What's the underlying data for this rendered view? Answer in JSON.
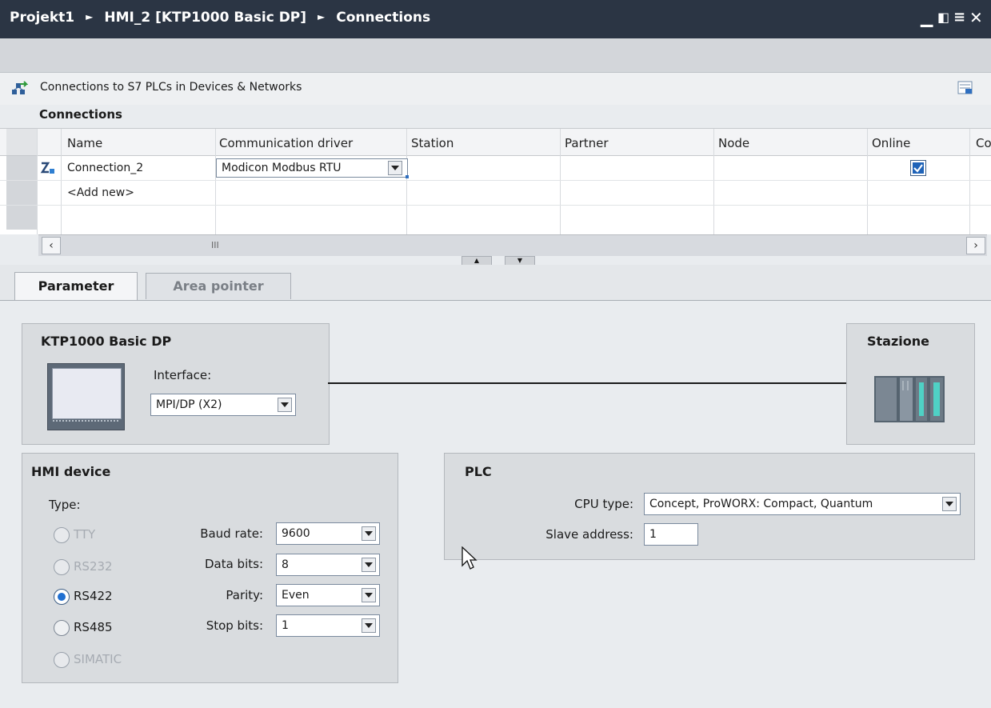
{
  "breadcrumb": [
    "Projekt1",
    "HMI_2 [KTP1000 Basic DP]",
    "Connections"
  ],
  "window_controls": [
    "minimize-icon",
    "restore-icon",
    "maximize-icon",
    "close-icon"
  ],
  "s7_link_label": "Connections to S7 PLCs in Devices & Networks",
  "connections_title": "Connections",
  "columns": [
    "Name",
    "Communication driver",
    "Station",
    "Partner",
    "Node",
    "Online",
    "Co"
  ],
  "rows": [
    {
      "name": "Connection_2",
      "driver": "Modicon Modbus RTU",
      "online": true
    },
    {
      "name": "<Add new>"
    }
  ],
  "scroll_thumb": "III",
  "tabs": [
    "Parameter",
    "Area pointer"
  ],
  "active_tab": "Parameter",
  "device_panel": {
    "title": "KTP1000 Basic DP",
    "interface_label": "Interface:",
    "interface_value": "MPI/DP (X2)"
  },
  "station_panel": {
    "title": "Stazione"
  },
  "hmi_panel": {
    "title": "HMI device",
    "type_label": "Type:",
    "types": [
      {
        "label": "TTY",
        "state": "disabled"
      },
      {
        "label": "RS232",
        "state": "disabled"
      },
      {
        "label": "RS422",
        "state": "selected"
      },
      {
        "label": "RS485",
        "state": "enabled"
      },
      {
        "label": "SIMATIC",
        "state": "disabled"
      }
    ],
    "baud_rate": {
      "label": "Baud rate:",
      "value": "9600"
    },
    "data_bits": {
      "label": "Data bits:",
      "value": "8"
    },
    "parity": {
      "label": "Parity:",
      "value": "Even"
    },
    "stop_bits": {
      "label": "Stop bits:",
      "value": "1"
    }
  },
  "plc_panel": {
    "title": "PLC",
    "cpu_type": {
      "label": "CPU type:",
      "value": "Concept, ProWORX: Compact, Quantum"
    },
    "slave_address": {
      "label": "Slave address:",
      "value": "1"
    }
  }
}
